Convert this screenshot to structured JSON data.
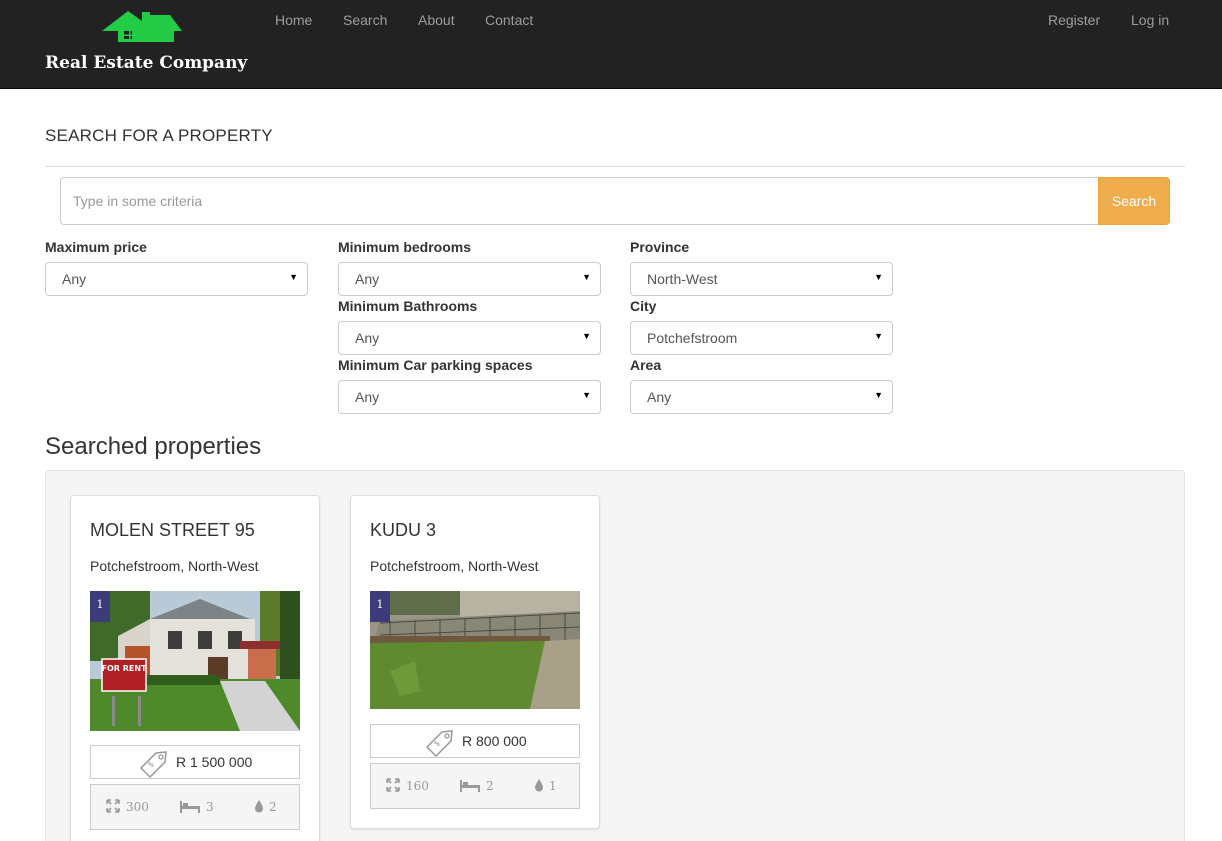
{
  "brand": {
    "name": "Real Estate Company",
    "color": "#22cc44"
  },
  "nav": {
    "home": "Home",
    "search": "Search",
    "about": "About",
    "contact": "Contact",
    "register": "Register",
    "login": "Log in"
  },
  "search": {
    "title": "SEARCH FOR A PROPERTY",
    "placeholder": "Type in some criteria",
    "button_label": "Search",
    "button_color": "#f0ad4e"
  },
  "filters": {
    "max_price": {
      "label": "Maximum price",
      "value": "Any"
    },
    "min_bedrooms": {
      "label": "Minimum bedrooms",
      "value": "Any"
    },
    "min_bathrooms": {
      "label": "Minimum Bathrooms",
      "value": "Any"
    },
    "min_parking": {
      "label": "Minimum Car parking spaces",
      "value": "Any"
    },
    "province": {
      "label": "Province",
      "value": "North-West"
    },
    "city": {
      "label": "City",
      "value": "Potchefstroom"
    },
    "area": {
      "label": "Area",
      "value": "Any"
    }
  },
  "results": {
    "title": "Searched properties",
    "properties": [
      {
        "name": "MOLEN STREET 95",
        "location": "Potchefstroom, North-West",
        "photo_count": "1",
        "price": "R 1 500 000",
        "size": "300",
        "bedrooms": "3",
        "bathrooms": "2",
        "sign_text": "FOR RENT"
      },
      {
        "name": "KUDU 3",
        "location": "Potchefstroom, North-West",
        "photo_count": "1",
        "price": "R 800 000",
        "size": "160",
        "bedrooms": "2",
        "bathrooms": "1"
      }
    ]
  },
  "icons": {
    "logo": "house-icon",
    "price": "price-tag-icon",
    "size": "expand-icon",
    "bedrooms": "bed-icon",
    "bathrooms": "water-drop-icon",
    "select": "caret-down-icon"
  }
}
